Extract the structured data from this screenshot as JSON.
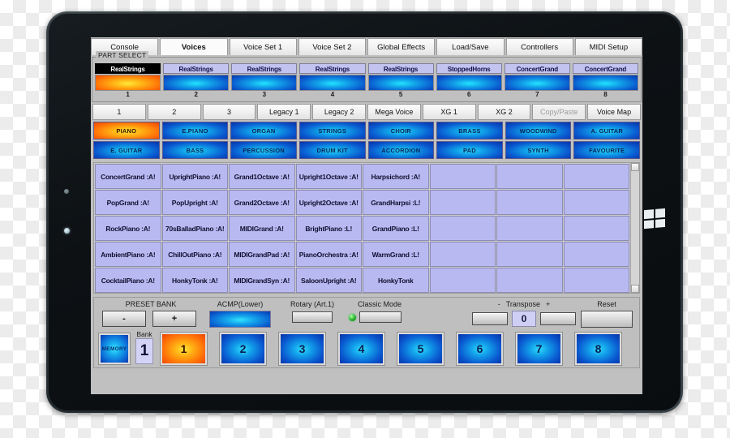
{
  "device": {
    "logo": "windows-logo"
  },
  "tabs": [
    {
      "label": "Console",
      "active": false
    },
    {
      "label": "Voices",
      "active": true
    },
    {
      "label": "Voice Set 1",
      "active": false
    },
    {
      "label": "Voice Set 2",
      "active": false
    },
    {
      "label": "Global Effects",
      "active": false
    },
    {
      "label": "Load/Save",
      "active": false
    },
    {
      "label": "Controllers",
      "active": false
    },
    {
      "label": "MIDI Setup",
      "active": false
    }
  ],
  "part_select": {
    "legend": "PART SELECT",
    "parts": [
      {
        "name": "RealStrings",
        "num": "1",
        "selected": true
      },
      {
        "name": "RealStrings",
        "num": "2",
        "selected": false
      },
      {
        "name": "RealStrings",
        "num": "3",
        "selected": false
      },
      {
        "name": "RealStrings",
        "num": "4",
        "selected": false
      },
      {
        "name": "RealStrings",
        "num": "5",
        "selected": false
      },
      {
        "name": "StoppedHorns",
        "num": "6",
        "selected": false
      },
      {
        "name": "ConcertGrand",
        "num": "7",
        "selected": false
      },
      {
        "name": "ConcertGrand",
        "num": "8",
        "selected": false
      }
    ]
  },
  "bank_row": [
    {
      "label": "1",
      "dim": false
    },
    {
      "label": "2",
      "dim": false
    },
    {
      "label": "3",
      "dim": false
    },
    {
      "label": "Legacy 1",
      "dim": false
    },
    {
      "label": "Legacy 2",
      "dim": false
    },
    {
      "label": "Mega Voice",
      "dim": false
    },
    {
      "label": "XG 1",
      "dim": false
    },
    {
      "label": "XG 2",
      "dim": false
    },
    {
      "label": "Copy/Paste",
      "dim": true
    },
    {
      "label": "Voice Map",
      "dim": false
    }
  ],
  "categories_row1": [
    {
      "label": "PIANO",
      "selected": true
    },
    {
      "label": "E.PIANO",
      "selected": false
    },
    {
      "label": "ORGAN",
      "selected": false
    },
    {
      "label": "STRINGS",
      "selected": false
    },
    {
      "label": "CHOIR",
      "selected": false
    },
    {
      "label": "BRASS",
      "selected": false
    },
    {
      "label": "WOODWIND",
      "selected": false
    },
    {
      "label": "A. GUITAR",
      "selected": false
    }
  ],
  "categories_row2": [
    {
      "label": "E. GUITAR",
      "selected": false
    },
    {
      "label": "BASS",
      "selected": false
    },
    {
      "label": "PERCUSSION",
      "selected": false
    },
    {
      "label": "DRUM KIT",
      "selected": false
    },
    {
      "label": "ACCORDION",
      "selected": false
    },
    {
      "label": "PAD",
      "selected": false
    },
    {
      "label": "SYNTH",
      "selected": false
    },
    {
      "label": "FAVOURITE",
      "selected": false
    }
  ],
  "voice_grid": {
    "columns": 8,
    "rows": [
      [
        "ConcertGrand  :A!",
        "UprightPiano  :A!",
        "Grand1Octave  :A!",
        "Upright1Octave  :A!",
        "Harpsichord  :A!",
        "",
        "",
        ""
      ],
      [
        "PopGrand  :A!",
        "PopUpright  :A!",
        "Grand2Octave  :A!",
        "Upright2Octave  :A!",
        "GrandHarpsi :L!",
        "",
        "",
        ""
      ],
      [
        "RockPiano :A!",
        "70sBalladPiano  :A!",
        "MIDIGrand  :A!",
        "BrightPiano :L!",
        "GrandPiano :L!",
        "",
        "",
        ""
      ],
      [
        "AmbientPiano  :A!",
        "ChillOutPiano  :A!",
        "MIDIGrandPad  :A!",
        "PianoOrchestra  :A!",
        "WarmGrand :L!",
        "",
        "",
        ""
      ],
      [
        "CocktailPiano  :A!",
        "HonkyTonk  :A!",
        "MIDIGrandSyn  :A!",
        "SaloonUpright  :A!",
        "HonkyTonk",
        "",
        "",
        ""
      ]
    ]
  },
  "panel": {
    "preset_bank_label": "PRESET BANK",
    "preset_minus": "-",
    "preset_plus": "+",
    "acmp_label": "ACMP(Lower)",
    "rotary_label": "Rotary (Art.1)",
    "classic_label": "Classic Mode",
    "transpose_minus": "-",
    "transpose_label": "Transpose",
    "transpose_plus": "+",
    "transpose_value": "0",
    "reset_label": "Reset"
  },
  "registration": {
    "memory_label": "MEMORY",
    "bank_label": "Bank",
    "bank_value": "1",
    "buttons": [
      {
        "label": "1",
        "selected": true
      },
      {
        "label": "2",
        "selected": false
      },
      {
        "label": "3",
        "selected": false
      },
      {
        "label": "4",
        "selected": false
      },
      {
        "label": "5",
        "selected": false
      },
      {
        "label": "6",
        "selected": false
      },
      {
        "label": "7",
        "selected": false
      },
      {
        "label": "8",
        "selected": false
      }
    ]
  },
  "colors": {
    "accent_blue": "#10a0e8",
    "accent_orange": "#ffb415",
    "panel_gray": "#c0c0c0",
    "cell_lavender": "#b9b9f2"
  }
}
